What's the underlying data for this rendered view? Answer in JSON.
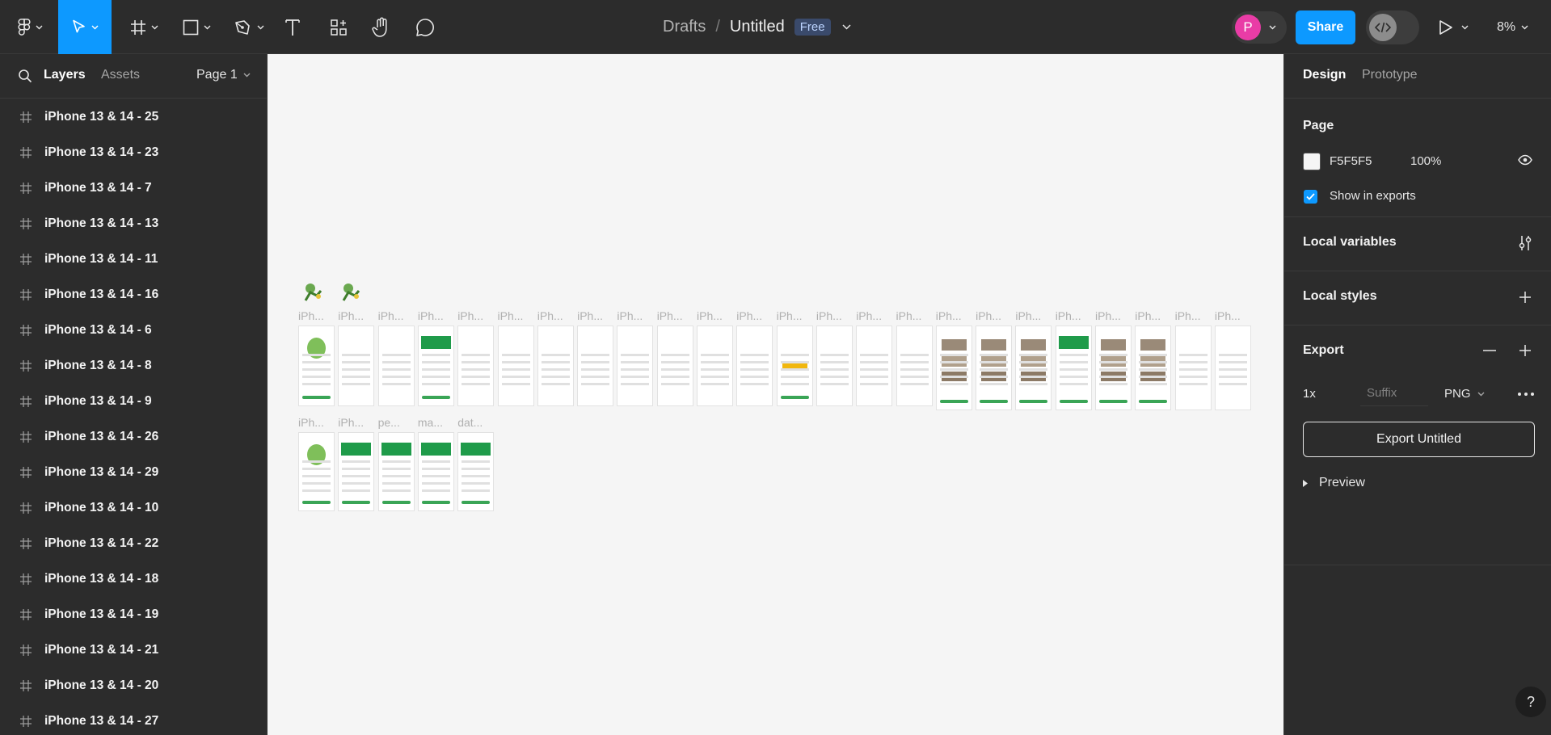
{
  "toolbar": {
    "tools": [
      "main-menu",
      "move-tool",
      "frame-tool",
      "shape-tool",
      "pen-tool",
      "text-tool",
      "resources-tool",
      "hand-tool",
      "comment-tool"
    ],
    "breadcrumb": {
      "folder": "Drafts",
      "separator": "/",
      "file": "Untitled",
      "plan_badge": "Free"
    },
    "avatar_initial": "P",
    "share_label": "Share",
    "zoom": "8%"
  },
  "left_panel": {
    "tabs": {
      "layers": "Layers",
      "assets": "Assets"
    },
    "page_selector": "Page 1",
    "layers": [
      "iPhone 13 & 14 - 25",
      "iPhone 13 & 14 - 23",
      "iPhone 13 & 14 - 7",
      "iPhone 13 & 14 - 13",
      "iPhone 13 & 14 - 11",
      "iPhone 13 & 14 - 16",
      "iPhone 13 & 14 - 6",
      "iPhone 13 & 14 - 8",
      "iPhone 13 & 14 - 9",
      "iPhone 13 & 14 - 26",
      "iPhone 13 & 14 - 29",
      "iPhone 13 & 14 - 10",
      "iPhone 13 & 14 - 22",
      "iPhone 13 & 14 - 18",
      "iPhone 13 & 14 - 19",
      "iPhone 13 & 14 - 21",
      "iPhone 13 & 14 - 20",
      "iPhone 13 & 14 - 27"
    ]
  },
  "canvas": {
    "row1_labels": [
      "iPh...",
      "iPh...",
      "iPh...",
      "iPh...",
      "iPh...",
      "iPh...",
      "iPh...",
      "iPh...",
      "iPh...",
      "iPh...",
      "iPh...",
      "iPh...",
      "iPh...",
      "iPh...",
      "iPh...",
      "iPh...",
      "iPh...",
      "iPh...",
      "iPh...",
      "iPh...",
      "iPh...",
      "iPh...",
      "iPh...",
      "iPh..."
    ],
    "row2_labels": [
      "iPh...",
      "iPh...",
      "pe...",
      "ma...",
      "dat..."
    ]
  },
  "right_panel": {
    "tabs": {
      "design": "Design",
      "prototype": "Prototype"
    },
    "page": {
      "title": "Page",
      "color_hex": "F5F5F5",
      "opacity": "100%",
      "show_in_exports": "Show in exports"
    },
    "local_variables": "Local variables",
    "local_styles": "Local styles",
    "export": {
      "title": "Export",
      "scale": "1x",
      "suffix_placeholder": "Suffix",
      "format": "PNG",
      "button": "Export Untitled",
      "preview": "Preview"
    },
    "help": "?"
  },
  "colors": {
    "accent": "#0d99ff",
    "panel": "#2c2c2c",
    "canvas": "#f5f5f5",
    "avatar": "#e93ca6",
    "badge": "#3a4a6b"
  }
}
